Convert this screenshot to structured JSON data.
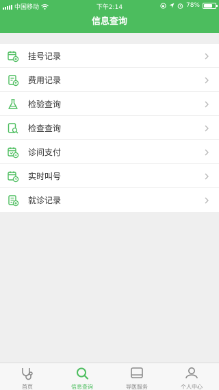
{
  "status_bar": {
    "carrier": "中国移动",
    "time": "下午2:14",
    "battery_percent": "78%",
    "battery_level": 0.78,
    "icons": [
      "signal-icon",
      "wifi-icon",
      "lock-rotation-icon",
      "location-icon",
      "alarm-icon",
      "battery-icon"
    ]
  },
  "header": {
    "title": "信息查询"
  },
  "menu": {
    "items": [
      {
        "label": "挂号记录",
        "icon": "calendar-register-icon"
      },
      {
        "label": "费用记录",
        "icon": "bill-icon"
      },
      {
        "label": "检验查询",
        "icon": "flask-icon"
      },
      {
        "label": "检查查询",
        "icon": "document-search-icon"
      },
      {
        "label": "诊间支付",
        "icon": "clinic-payment-icon"
      },
      {
        "label": "实时叫号",
        "icon": "realtime-queue-icon"
      },
      {
        "label": "就诊记录",
        "icon": "visit-record-icon"
      }
    ]
  },
  "tabbar": {
    "active_color": "#4cbd5e",
    "tabs": [
      {
        "label": "首页",
        "icon": "stethoscope-icon",
        "active": false
      },
      {
        "label": "信息查询",
        "icon": "search-icon",
        "active": true
      },
      {
        "label": "导医服务",
        "icon": "guide-service-icon",
        "active": false
      },
      {
        "label": "个人中心",
        "icon": "profile-icon",
        "active": false
      }
    ]
  },
  "colors": {
    "primary": "#4cbd5e",
    "background": "#efefef"
  }
}
